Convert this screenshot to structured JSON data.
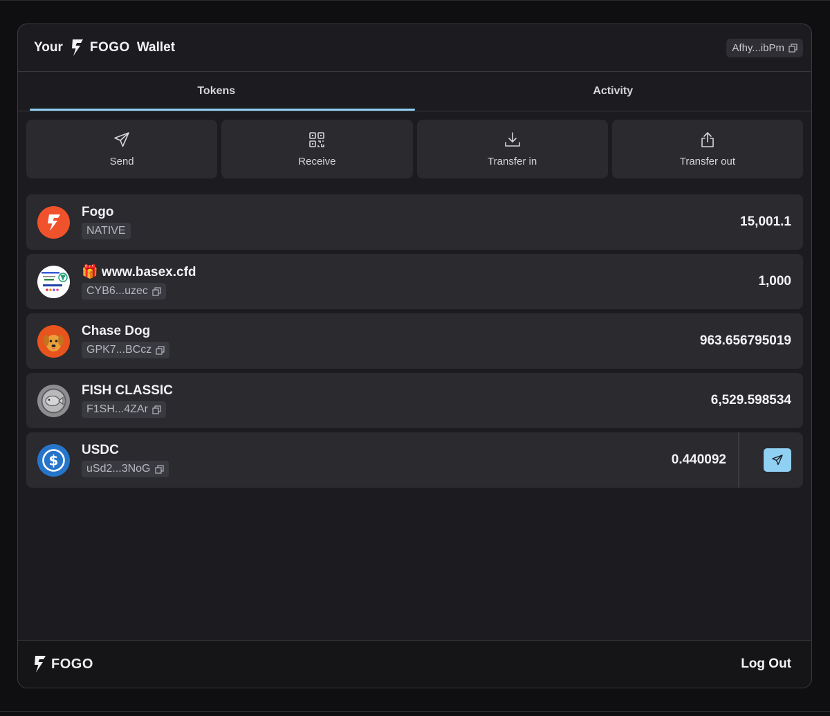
{
  "header": {
    "title_prefix": "Your",
    "title_brand": "FOGO",
    "title_suffix": "Wallet",
    "address": "Afhy...ibPm"
  },
  "tabs": [
    {
      "label": "Tokens",
      "active": true
    },
    {
      "label": "Activity",
      "active": false
    }
  ],
  "actions": [
    {
      "label": "Send",
      "icon": "send-icon"
    },
    {
      "label": "Receive",
      "icon": "qr-code-icon"
    },
    {
      "label": "Transfer in",
      "icon": "download-icon"
    },
    {
      "label": "Transfer out",
      "icon": "upload-icon"
    }
  ],
  "tokens": [
    {
      "name": "Fogo",
      "sub": "NATIVE",
      "amount": "15,001.1",
      "icon": "fogo-logo-icon"
    },
    {
      "name": "🎁 www.basex.cfd",
      "sub": "CYB6...uzec",
      "amount": "1,000",
      "icon": "basex-voucher-logo-icon"
    },
    {
      "name": "Chase Dog",
      "sub": "GPK7...BCcz",
      "amount": "963.656795019",
      "icon": "dog-logo-icon"
    },
    {
      "name": "FISH CLASSIC",
      "sub": "F1SH...4ZAr",
      "amount": "6,529.598534",
      "icon": "fish-logo-icon"
    },
    {
      "name": "USDC",
      "sub": "uSd2...3NoG",
      "amount": "0.440092",
      "icon": "usdc-logo-icon"
    }
  ],
  "footer": {
    "brand": "FOGO",
    "logout_label": "Log Out"
  },
  "colors": {
    "accent": "#8fd0f3",
    "fogo_orange": "#f0522b",
    "usdc_blue": "#2775ca",
    "panel": "#1c1c20",
    "row": "#2a2a2f"
  }
}
